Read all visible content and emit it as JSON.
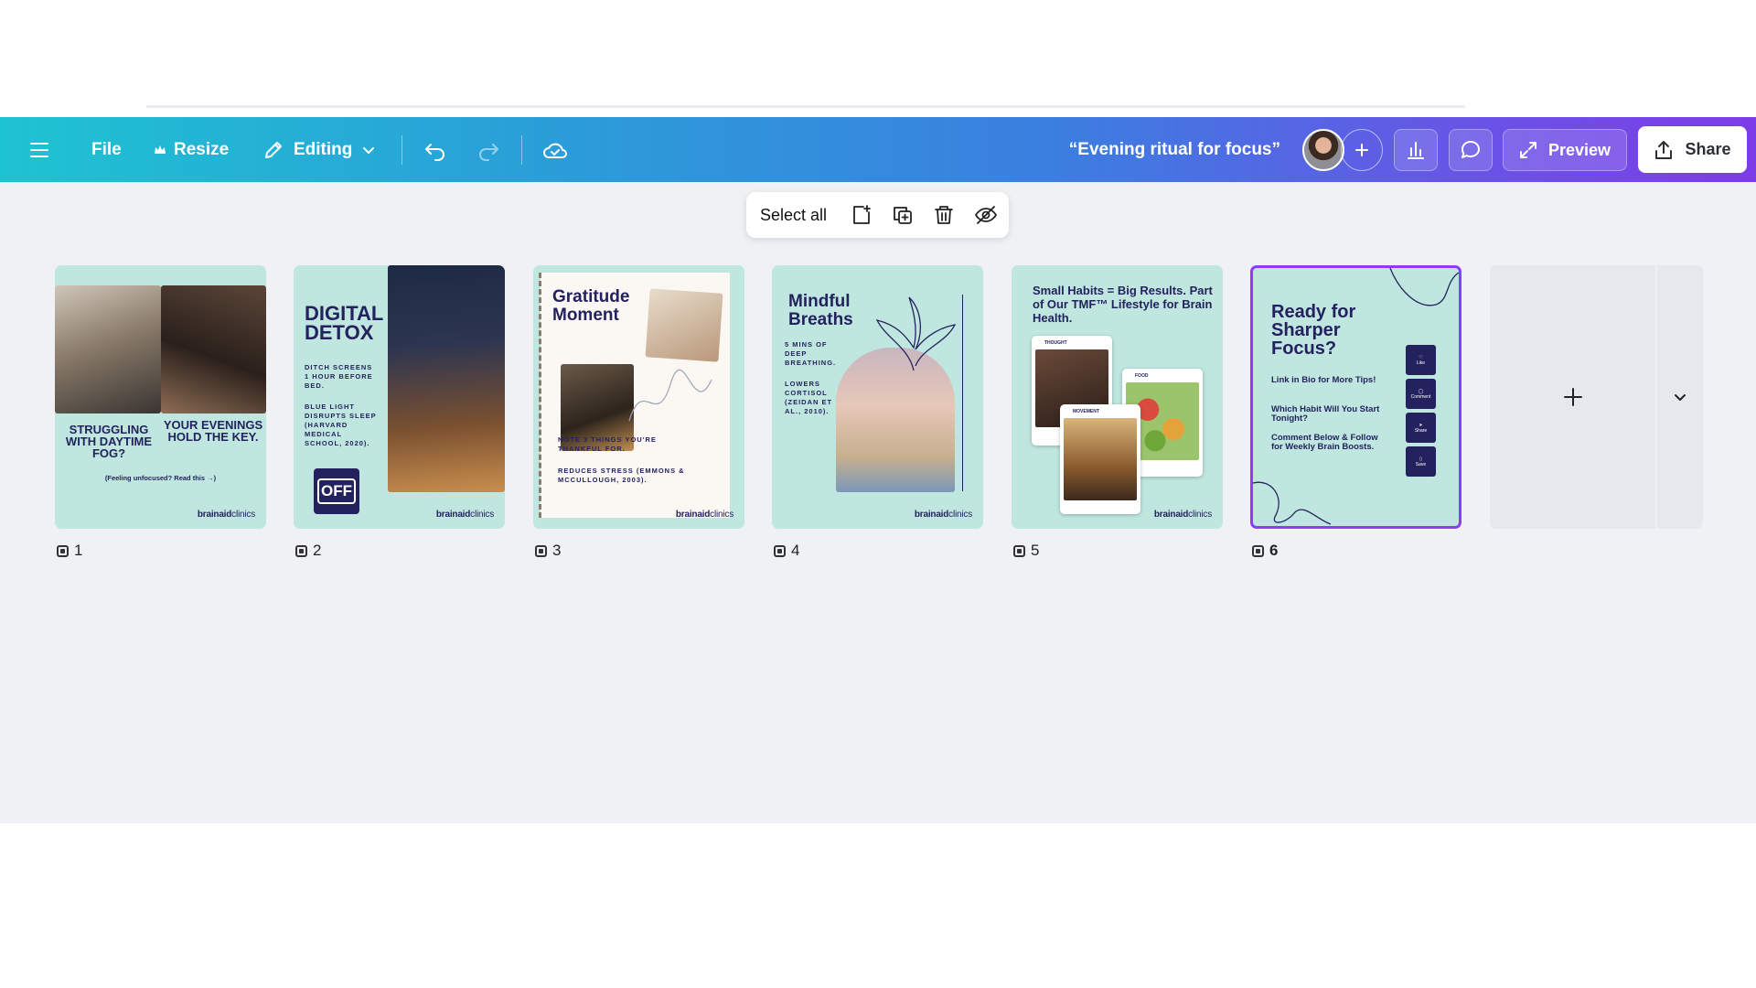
{
  "toolbar": {
    "file_label": "File",
    "resize_label": "Resize",
    "editing_label": "Editing",
    "doc_title": "“Evening ritual for focus”",
    "preview_label": "Preview",
    "share_label": "Share"
  },
  "selection_bar": {
    "select_all_label": "Select all"
  },
  "pages": [
    {
      "number": "1",
      "heading_left": "STRUGGLING WITH DAYTIME FOG?",
      "heading_right": "YOUR EVENINGS HOLD THE KEY.",
      "sub": "(Feeling unfocused? Read this →)"
    },
    {
      "number": "2",
      "title": "DIGITAL DETOX",
      "tip1": "DITCH SCREENS 1 HOUR BEFORE BED.",
      "tip2": "BLUE LIGHT DISRUPTS SLEEP (HARVARD MEDICAL SCHOOL, 2020).",
      "badge": "OFF"
    },
    {
      "number": "3",
      "title": "Gratitude Moment",
      "tip1": "NOTE 3 THINGS YOU'RE THANKFUL FOR.",
      "tip2": "REDUCES STRESS (EMMONS & MCCULLOUGH, 2003)."
    },
    {
      "number": "4",
      "title": "Mindful Breaths",
      "tip1": "5 MINS OF DEEP BREATHING.",
      "tip2": "LOWERS CORTISOL (ZEIDAN ET AL., 2010)."
    },
    {
      "number": "5",
      "title": "Small Habits = Big Results. Part of Our TMF™ Lifestyle for Brain Health.",
      "card1": "THOUGHT",
      "card2": "FOOD",
      "card3": "MOVEMENT"
    },
    {
      "number": "6",
      "title": "Ready for Sharper Focus?",
      "line1": "Link in Bio for More Tips!",
      "line2": "Which Habit Will You Start Tonight?",
      "line3": "Comment Below & Follow for Weekly Brain Boosts.",
      "icons": [
        "Like",
        "Comment",
        "Share",
        "Save"
      ]
    }
  ],
  "brand": {
    "bold": "brainaid",
    "light": "clinics"
  },
  "colors": {
    "accent": "#8b3dff",
    "navy": "#24225e",
    "page_bg": "#bfe7e0"
  }
}
